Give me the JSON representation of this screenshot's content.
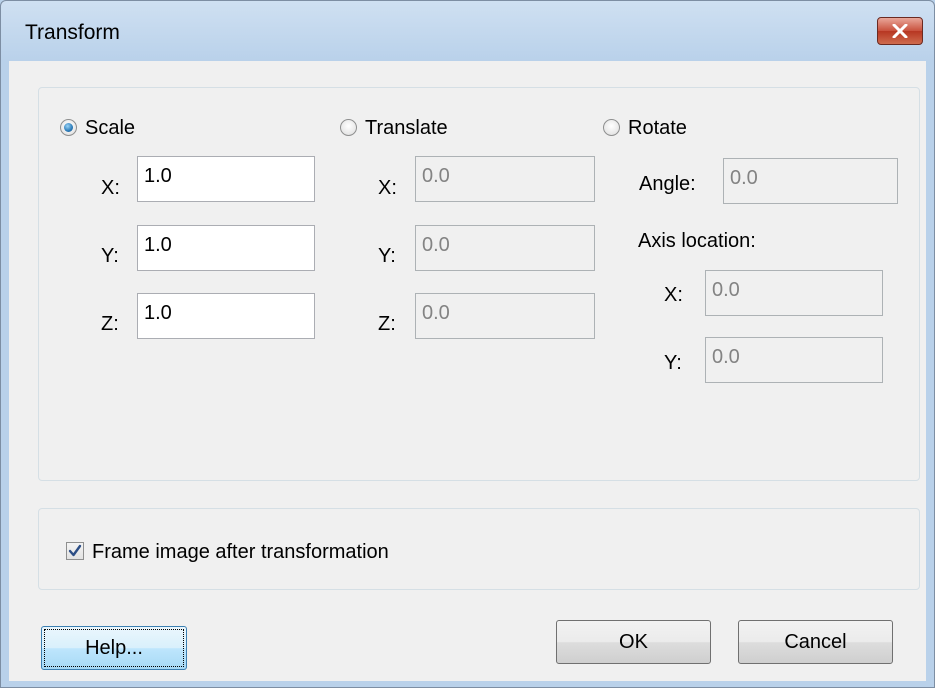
{
  "window": {
    "title": "Transform",
    "close_icon": "close-icon"
  },
  "transform": {
    "scale": {
      "label": "Scale",
      "selected": true,
      "x_label": "X:",
      "x_value": "1.0",
      "y_label": "Y:",
      "y_value": "1.0",
      "z_label": "Z:",
      "z_value": "1.0"
    },
    "translate": {
      "label": "Translate",
      "selected": false,
      "x_label": "X:",
      "x_value": "0.0",
      "y_label": "Y:",
      "y_value": "0.0",
      "z_label": "Z:",
      "z_value": "0.0"
    },
    "rotate": {
      "label": "Rotate",
      "selected": false,
      "angle_label": "Angle:",
      "angle_value": "0.0",
      "axis_location_label": "Axis location:",
      "axis_x_label": "X:",
      "axis_x_value": "0.0",
      "axis_y_label": "Y:",
      "axis_y_value": "0.0"
    }
  },
  "options": {
    "frame_image_label": "Frame image after transformation",
    "frame_image_checked": true
  },
  "buttons": {
    "help": "Help...",
    "ok": "OK",
    "cancel": "Cancel"
  },
  "colors": {
    "title_bar": "#b9d1ea",
    "dialog_background": "#f0f0f0",
    "close_button": "#c8503c",
    "radio_selected": "#2a7ab8"
  }
}
